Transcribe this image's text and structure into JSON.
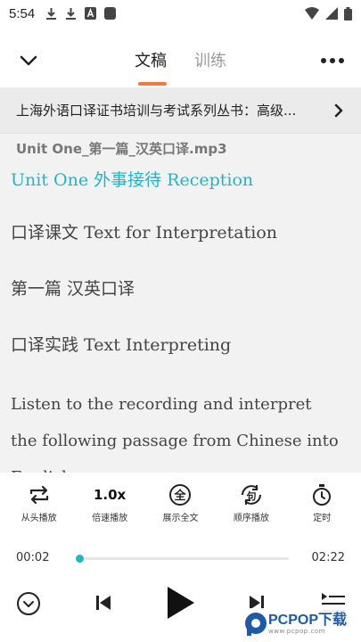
{
  "status_bar": {
    "time": "5:54",
    "icons": [
      "download-icon",
      "download-icon",
      "font-icon",
      "app-icon",
      "wifi-icon",
      "signal-icon",
      "battery-icon"
    ]
  },
  "nav": {
    "tabs": [
      {
        "label": "文稿",
        "active": true
      },
      {
        "label": "训练",
        "active": false
      }
    ],
    "accent_color": "#f07a3c"
  },
  "book": {
    "title": "上海外语口译证书培训与考试系列丛书：高级..."
  },
  "document": {
    "file_name": "Unit One_第一篇_汉英口译.mp3",
    "lines": [
      "Unit One 外事接待 Reception",
      "口译课文 Text for Interpretation",
      "第一篇 汉英口译",
      "口译实践 Text Interpreting",
      "Listen to the recording and interpret",
      "the following passage from Chinese into",
      "English."
    ],
    "highlight_color": "#1fb5c9"
  },
  "controls": [
    {
      "label": "从头播放",
      "icon": "repeat-icon"
    },
    {
      "label": "倍速播放",
      "icon": "speed-icon",
      "value": "1.0x"
    },
    {
      "label": "展示全文",
      "icon": "full-text-icon",
      "glyph": "全"
    },
    {
      "label": "顺序播放",
      "icon": "sequential-play-icon",
      "glyph": "句"
    },
    {
      "label": "定时",
      "icon": "timer-icon"
    }
  ],
  "progress": {
    "current": "00:02",
    "total": "02:22",
    "fraction": 0.014
  },
  "player": {
    "buttons": [
      "collapse-icon",
      "previous-icon",
      "play-icon",
      "next-icon",
      "playlist-icon"
    ]
  },
  "watermark": {
    "brand": "PCPOP下载",
    "sub": "www.pcpop.com"
  }
}
